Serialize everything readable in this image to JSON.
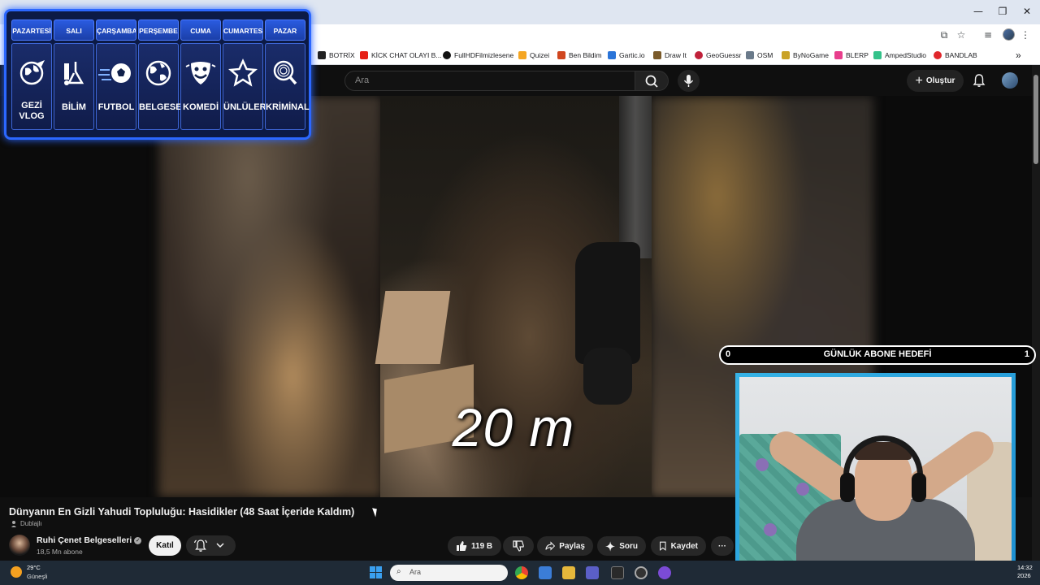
{
  "window": {
    "controls": {
      "minimize": "—",
      "restore": "❐",
      "close": "✕"
    }
  },
  "bookmarks": [
    {
      "label": "BOTRİX",
      "color": "#222222"
    },
    {
      "label": "KİCK CHAT OLAYI B...",
      "color": "#e62117"
    },
    {
      "label": "FullHDFilmizlesene",
      "color": "#111111"
    },
    {
      "label": "Quizei",
      "color": "#f5a623"
    },
    {
      "label": "Ben Bildim",
      "color": "#d0461f"
    },
    {
      "label": "Gartic.io",
      "color": "#2a74d8"
    },
    {
      "label": "Draw It",
      "color": "#7a5a2a"
    },
    {
      "label": "GeoGuessr",
      "color": "#c0213a"
    },
    {
      "label": "OSM",
      "color": "#6a7a8a"
    },
    {
      "label": "ByNoGame",
      "color": "#c9a227"
    },
    {
      "label": "BLERP",
      "color": "#e83e8c"
    },
    {
      "label": "AmpedStudio",
      "color": "#34c28a"
    },
    {
      "label": "BANDLAB",
      "color": "#e0262b"
    }
  ],
  "youtube": {
    "search_placeholder": "Ara",
    "create_label": "Oluştur",
    "video_overlay_text": "20 m",
    "video_title": "Dünyanın En Gizli Yahudi Topluluğu: Hasidikler (48 Saat İçeride Kaldım)",
    "dub_label": "Dublajlı",
    "channel_name": "Ruhi Çenet Belgeselleri",
    "subscribers": "18,5 Mn abone",
    "join_label": "Katıl",
    "like_count": "119 B",
    "share_label": "Paylaş",
    "ask_label": "Soru",
    "save_label": "Kaydet",
    "more_label": "···"
  },
  "schedule": [
    {
      "day": "PAZARTESİ",
      "icon": "globe-plane-icon",
      "glyph": "🌍",
      "label": "GEZİ VLOG"
    },
    {
      "day": "SALI",
      "icon": "science-icon",
      "glyph": "⚗",
      "label": "BİLİM"
    },
    {
      "day": "ÇARŞAMBA",
      "icon": "football-icon",
      "glyph": "⚽",
      "label": "FUTBOL"
    },
    {
      "day": "PERŞEMBE",
      "icon": "earth-icon",
      "glyph": "🌐",
      "label": "BELGESEL"
    },
    {
      "day": "CUMA",
      "icon": "theater-masks-icon",
      "glyph": "🎭",
      "label": "KOMEDİ"
    },
    {
      "day": "CUMARTESİ",
      "icon": "star-icon",
      "glyph": "☆",
      "label": "ÜNLÜLER"
    },
    {
      "day": "PAZAR",
      "icon": "fingerprint-magnifier-icon",
      "glyph": "🔍",
      "label": "KRİMİNAL"
    }
  ],
  "goal": {
    "current": "0",
    "title": "GÜNLÜK ABONE HEDEFİ",
    "target": "1"
  },
  "taskbar": {
    "temperature": "29°C",
    "weather": "Güneşli",
    "search_placeholder": "Ara",
    "time": "14:32",
    "date": "2026"
  },
  "colors": {
    "accent_blue": "#2b67ff",
    "yt_bg": "#0f0f0f",
    "webcam_frame": "#36b3e6"
  }
}
